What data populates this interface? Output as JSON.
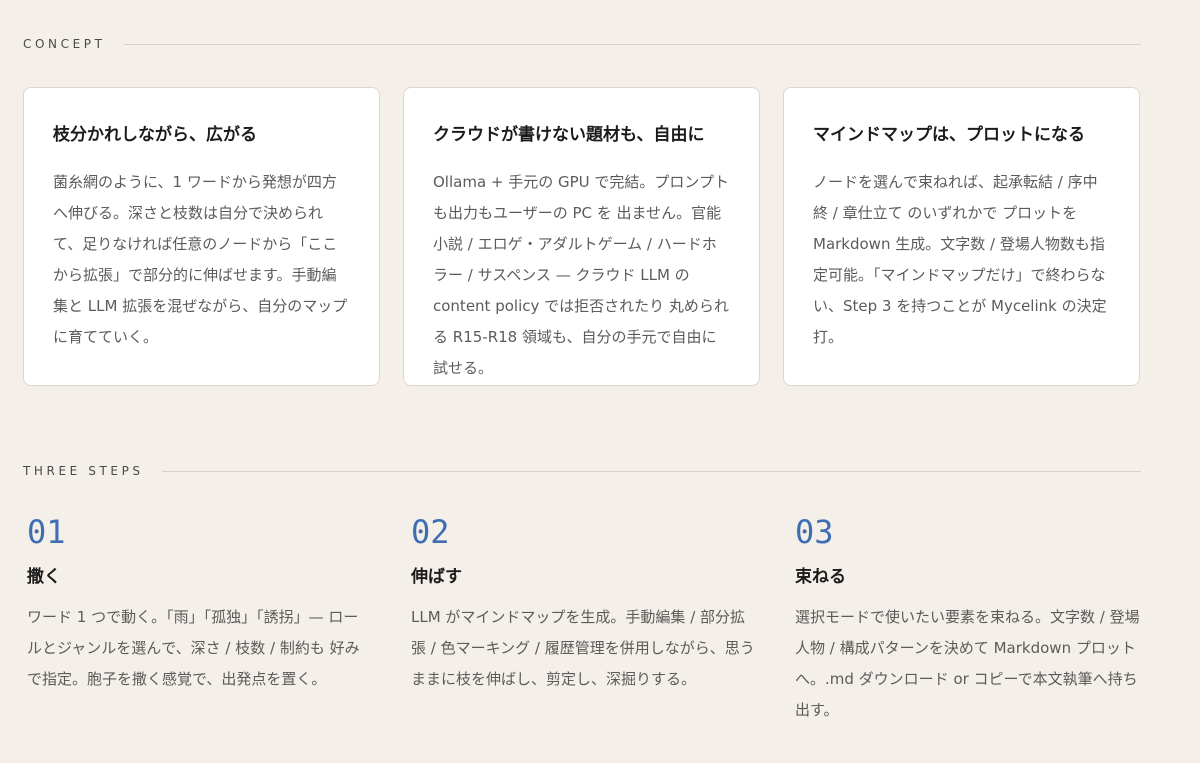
{
  "concept": {
    "label": "CONCEPT",
    "cards": [
      {
        "title": "枝分かれしながら、広がる",
        "body": "菌糸網のように、1 ワードから発想が四方へ伸びる。深さと枝数は自分で決められて、足りなければ任意のノードから「ここから拡張」で部分的に伸ばせます。手動編集と LLM 拡張を混ぜながら、自分のマップに育てていく。"
      },
      {
        "title": "クラウドが書けない題材も、自由に",
        "body": "Ollama + 手元の GPU で完結。プロンプトも出力もユーザーの PC を 出ません。官能小説 / エロゲ・アダルトゲーム / ハードホラー / サスペンス — クラウド LLM の content policy では拒否されたり 丸められる R15-R18 領域も、自分の手元で自由に試せる。"
      },
      {
        "title": "マインドマップは、プロットになる",
        "body": "ノードを選んで束ねれば、起承転結 / 序中終 / 章仕立て のいずれかで プロットを Markdown 生成。文字数 / 登場人物数も指定可能。「マインドマップだけ」で終わらない、Step 3 を持つことが Mycelink の決定打。"
      }
    ]
  },
  "steps": {
    "label": "THREE STEPS",
    "items": [
      {
        "num": "01",
        "title": "撒く",
        "body": "ワード 1 つで動く。「雨」「孤独」「誘拐」— ロールとジャンルを選んで、深さ / 枝数 / 制約も 好みで指定。胞子を撒く感覚で、出発点を置く。"
      },
      {
        "num": "02",
        "title": "伸ばす",
        "body": "LLM がマインドマップを生成。手動編集 / 部分拡張 / 色マーキング / 履歴管理を併用しながら、思うままに枝を伸ばし、剪定し、深掘りする。"
      },
      {
        "num": "03",
        "title": "束ねる",
        "body": "選択モードで使いたい要素を束ねる。文字数 / 登場人物 / 構成パターンを決めて Markdown プロットへ。.md ダウンロード or コピーで本文執筆へ持ち出す。"
      }
    ]
  },
  "colors": {
    "background": "#f4f0e9",
    "card": "#ffffff",
    "accent": "#3f6db3"
  }
}
